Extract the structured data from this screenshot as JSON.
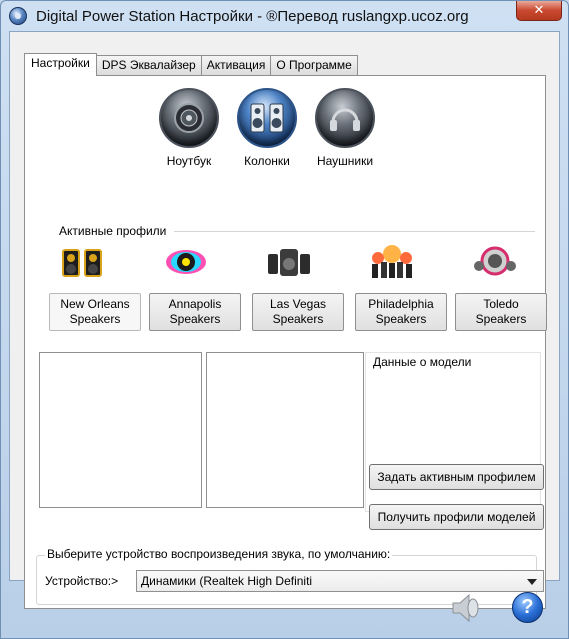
{
  "window": {
    "title": "Digital Power Station Настройки - ®Перевод ruslangxp.ucoz.org",
    "close_glyph": "✕"
  },
  "tabs": [
    {
      "label": "Настройки",
      "active": true
    },
    {
      "label": "DPS Эквалайзер",
      "active": false
    },
    {
      "label": "Активация",
      "active": false
    },
    {
      "label": "О Программе",
      "active": false
    }
  ],
  "modes": [
    {
      "label": "Ноутбук",
      "icon": "speaker-icon"
    },
    {
      "label": "Колонки",
      "icon": "speakers-icon"
    },
    {
      "label": "Наушники",
      "icon": "headphones-icon"
    }
  ],
  "profiles_section_label": "Активные профили",
  "profiles": [
    {
      "label_line1": "New Orleans",
      "label_line2": "Speakers",
      "active": true,
      "icon": "jazz-speakers-icon"
    },
    {
      "label_line1": "Annapolis",
      "label_line2": "Speakers",
      "active": false,
      "icon": "colorful-speaker-icon"
    },
    {
      "label_line1": "Las Vegas",
      "label_line2": "Speakers",
      "active": false,
      "icon": "subwoofer-speakers-icon"
    },
    {
      "label_line1": "Philadelphia",
      "label_line2": "Speakers",
      "active": false,
      "icon": "crowd-icon"
    },
    {
      "label_line1": "Toledo",
      "label_line2": "Speakers",
      "active": false,
      "icon": "speaker-set-icon"
    }
  ],
  "model_data_label": "Данные о модели",
  "set_active_profile_button": "Задать активным профилем",
  "get_model_profiles_button": "Получить профили моделей",
  "device_group_label": "Выберите устройство воспроизведения звука, по умолчанию:",
  "device_label": "Устройство:>",
  "device_value": "Динамики (Realtek High Definiti",
  "help_glyph": "?"
}
